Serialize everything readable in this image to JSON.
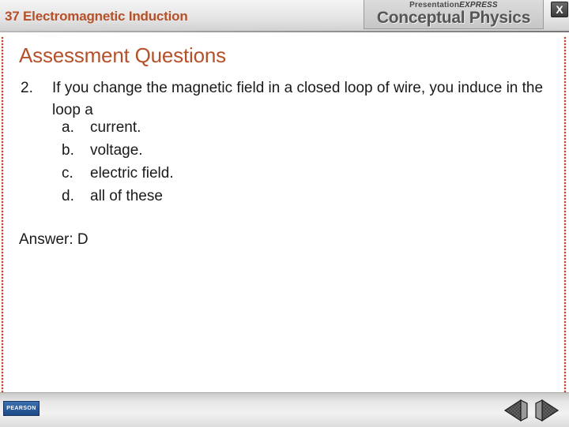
{
  "header": {
    "chapter_number": "37",
    "chapter_title": "Electromagnetic Induction",
    "brand_small_prefix": "Presentation",
    "brand_small_suffix": "EXPRESS",
    "brand_title": "Conceptual Physics",
    "close_label": "X"
  },
  "slide": {
    "title": "Assessment Questions",
    "question_number": "2.",
    "question_text": "If you change the magnetic field in a closed loop of wire, you induce in the loop a",
    "choices": [
      {
        "letter": "a.",
        "text": "current."
      },
      {
        "letter": "b.",
        "text": "voltage."
      },
      {
        "letter": "c.",
        "text": "electric field."
      },
      {
        "letter": "d.",
        "text": "all of these"
      }
    ],
    "answer": "Answer: D"
  },
  "footer": {
    "logo_text": "PEARSON",
    "prev_icon": "previous-arrow-icon",
    "next_icon": "next-arrow-icon"
  },
  "colors": {
    "accent": "#b5512a",
    "text": "#1a1a1a"
  }
}
